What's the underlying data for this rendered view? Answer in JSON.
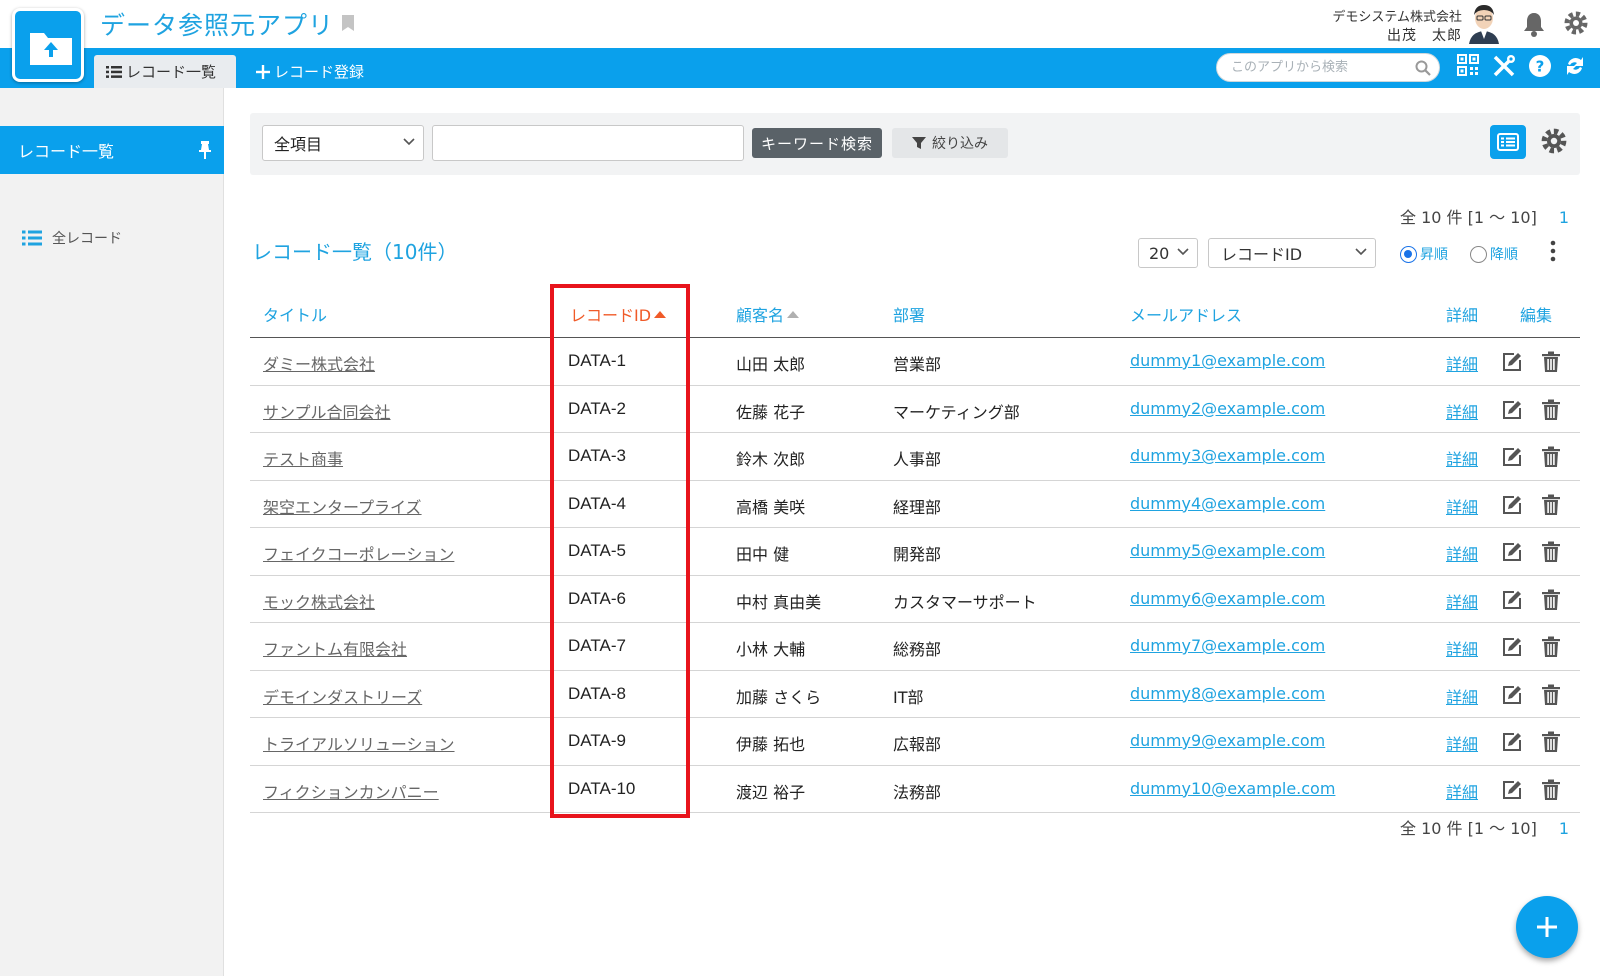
{
  "app": {
    "title": "データ参照元アプリ",
    "company": "デモシステム株式会社",
    "user": "出茂　太郎"
  },
  "tabs": {
    "list": "レコード一覧",
    "add": "レコード登録"
  },
  "header_search": {
    "placeholder": "このアプリから検索"
  },
  "sidebar": {
    "active": "レコード一覧",
    "items": [
      {
        "label": "全レコード"
      }
    ]
  },
  "search_panel": {
    "field_select": "全項目",
    "keyword_value": "",
    "keyword_button": "キーワード検索",
    "filter_button": "絞り込み"
  },
  "pager": {
    "summary": "全 10 件 [1 〜 10]",
    "page": "1"
  },
  "list": {
    "title": "レコード一覧（10件）",
    "per_page": "20",
    "sort_field": "レコードID",
    "asc_label": "昇順",
    "desc_label": "降順",
    "sort_order": "asc"
  },
  "table": {
    "columns": [
      "タイトル",
      "レコードID",
      "顧客名",
      "部署",
      "メールアドレス",
      "詳細",
      "編集"
    ],
    "rows": [
      {
        "title": "ダミー株式会社",
        "id": "DATA-1",
        "customer": "山田 太郎",
        "dept": "営業部",
        "email": "dummy1@example.com",
        "detail": "詳細"
      },
      {
        "title": "サンプル合同会社",
        "id": "DATA-2",
        "customer": "佐藤 花子",
        "dept": "マーケティング部",
        "email": "dummy2@example.com",
        "detail": "詳細"
      },
      {
        "title": "テスト商事",
        "id": "DATA-3",
        "customer": "鈴木 次郎",
        "dept": "人事部",
        "email": "dummy3@example.com",
        "detail": "詳細"
      },
      {
        "title": "架空エンタープライズ",
        "id": "DATA-4",
        "customer": "高橋 美咲",
        "dept": "経理部",
        "email": "dummy4@example.com",
        "detail": "詳細"
      },
      {
        "title": "フェイクコーポレーション",
        "id": "DATA-5",
        "customer": "田中 健",
        "dept": "開発部",
        "email": "dummy5@example.com",
        "detail": "詳細"
      },
      {
        "title": "モック株式会社",
        "id": "DATA-6",
        "customer": "中村 真由美",
        "dept": "カスタマーサポート",
        "email": "dummy6@example.com",
        "detail": "詳細"
      },
      {
        "title": "ファントム有限会社",
        "id": "DATA-7",
        "customer": "小林 大輔",
        "dept": "総務部",
        "email": "dummy7@example.com",
        "detail": "詳細"
      },
      {
        "title": "デモインダストリーズ",
        "id": "DATA-8",
        "customer": "加藤 さくら",
        "dept": "IT部",
        "email": "dummy8@example.com",
        "detail": "詳細"
      },
      {
        "title": "トライアルソリューション",
        "id": "DATA-9",
        "customer": "伊藤 拓也",
        "dept": "広報部",
        "email": "dummy9@example.com",
        "detail": "詳細"
      },
      {
        "title": "フィクションカンパニー",
        "id": "DATA-10",
        "customer": "渡辺 裕子",
        "dept": "法務部",
        "email": "dummy10@example.com",
        "detail": "詳細"
      }
    ]
  },
  "colors": {
    "brand": "#0aa0ec",
    "link": "#1fa3e0",
    "sort_active": "#f05a28",
    "sort_inactive": "#b0b0b0",
    "highlight": "#e8141c"
  },
  "icons": [
    "folder-upload-icon",
    "bookmark-icon",
    "avatar",
    "bell-icon",
    "gear-icon",
    "list-icon",
    "plus-icon",
    "search-icon",
    "qr-code-icon",
    "tools-icon",
    "help-icon",
    "sync-icon",
    "pin-icon",
    "filter-icon",
    "list-view-icon",
    "kebab-icon",
    "edit-icon",
    "trash-icon",
    "chevron-down-icon"
  ]
}
